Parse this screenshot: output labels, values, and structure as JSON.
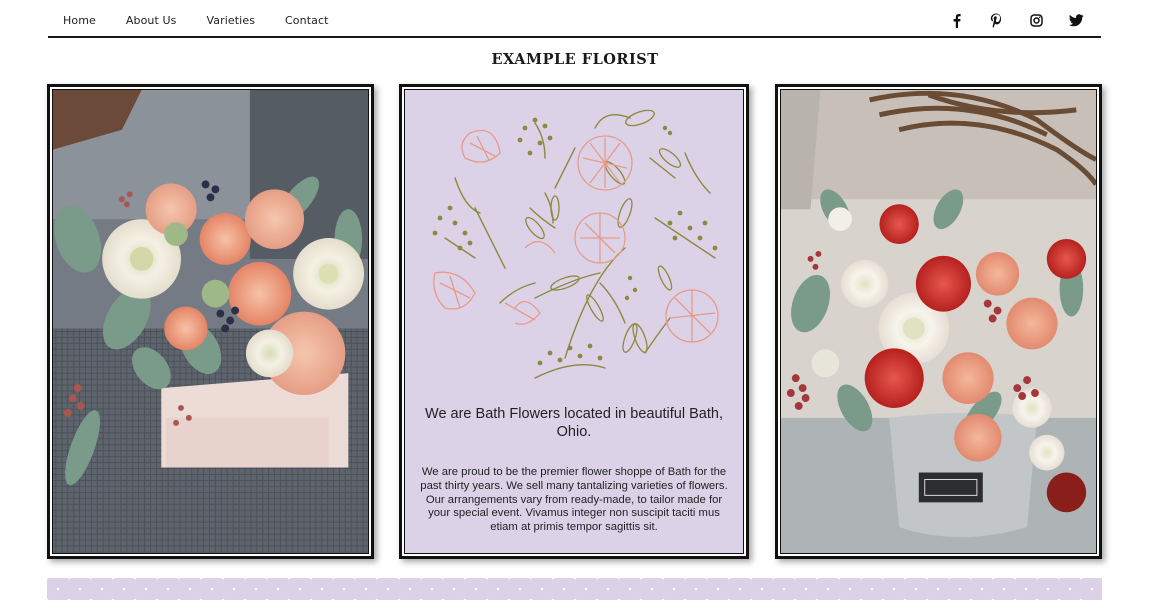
{
  "nav": {
    "links": [
      "Home",
      "About Us",
      "Varieties",
      "Contact"
    ],
    "social": [
      "facebook-icon",
      "pinterest-icon",
      "instagram-icon",
      "twitter-icon"
    ]
  },
  "site_title": "EXAMPLE FLORIST",
  "about": {
    "heading": "We are Bath Flowers located in beautiful Bath, Ohio.",
    "body": "We are proud to be the premier flower shoppe of Bath for the past thirty years. We sell many tantalizing varieties of flowers. Our arrangements vary from ready-made, to tailor made for your special event. Vivamus integer non suscipit taciti mus etiam at primis tempor sagittis sit."
  },
  "colors": {
    "panel_bg": "#dcd2e8",
    "leaf": "#8a8a3c",
    "petal": "#e89a88"
  }
}
